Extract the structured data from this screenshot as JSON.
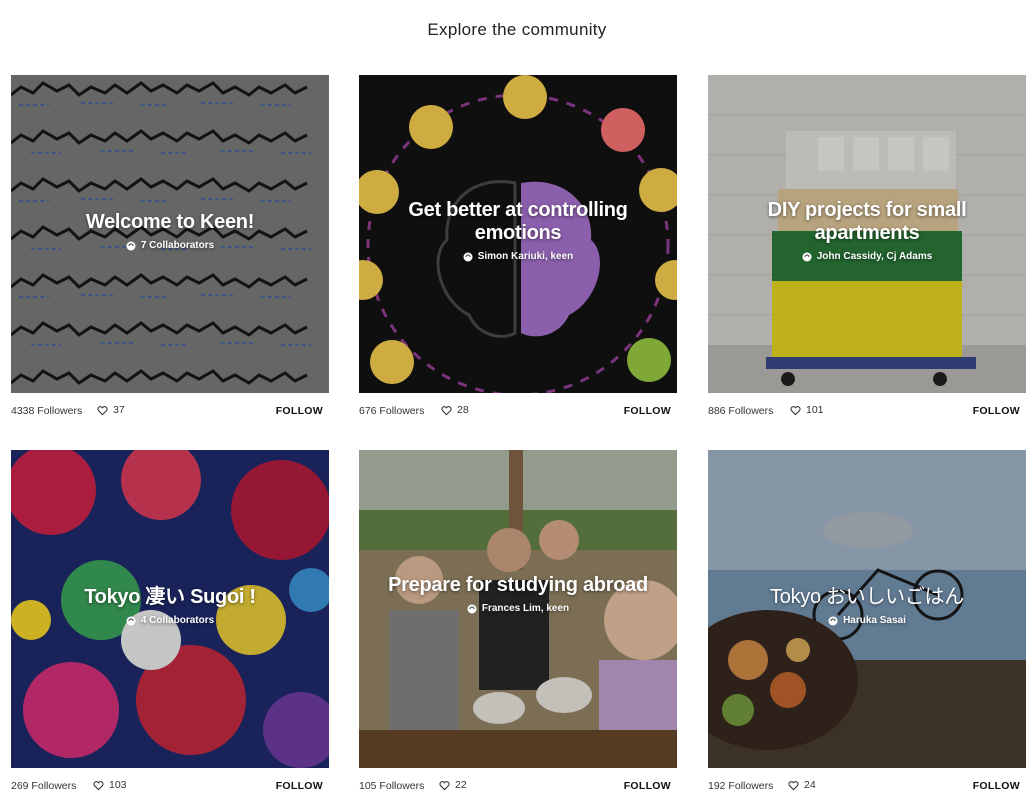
{
  "header": {
    "title": "Explore the community"
  },
  "cards": [
    {
      "title": "Welcome to Keen!",
      "subtitle": "7 Collaborators",
      "followers": "4338 Followers",
      "likes": "37",
      "follow": "FOLLOW"
    },
    {
      "title": "Get better at controlling emotions",
      "subtitle": "Simon Kariuki, keen",
      "followers": "676 Followers",
      "likes": "28",
      "follow": "FOLLOW"
    },
    {
      "title": "DIY projects for small apartments",
      "subtitle": "John Cassidy, Cj Adams",
      "followers": "886 Followers",
      "likes": "101",
      "follow": "FOLLOW"
    },
    {
      "title": "Tokyo 凄い Sugoi !",
      "subtitle": "4 Collaborators",
      "followers": "269 Followers",
      "likes": "103",
      "follow": "FOLLOW"
    },
    {
      "title": "Prepare for studying abroad",
      "subtitle": "Frances Lim, keen",
      "followers": "105 Followers",
      "likes": "22",
      "follow": "FOLLOW"
    },
    {
      "title": "Tokyo おいしいごはん",
      "subtitle": "Haruka Sasai",
      "followers": "192 Followers",
      "likes": "24",
      "follow": "FOLLOW"
    }
  ],
  "icons": {
    "collaborator": "collaborator-icon",
    "like": "heart-icon"
  }
}
